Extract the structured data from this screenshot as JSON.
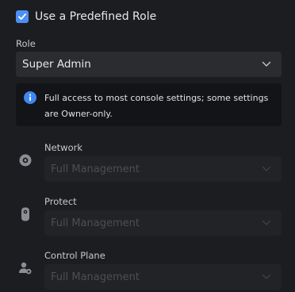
{
  "predefined_role": {
    "label": "Use a Predefined Role",
    "checked": true
  },
  "role": {
    "label": "Role",
    "value": "Super Admin"
  },
  "info": {
    "text": "Full access to most console settings; some settings are Owner-only."
  },
  "permissions": [
    {
      "label": "Network",
      "value": "Full Management",
      "icon": "network-icon"
    },
    {
      "label": "Protect",
      "value": "Full Management",
      "icon": "protect-camera-icon"
    },
    {
      "label": "Control Plane",
      "value": "Full Management",
      "icon": "control-plane-user-gear-icon"
    }
  ],
  "colors": {
    "accent": "#4c8ff5",
    "background": "#1c1d20",
    "field": "#2a2c30",
    "info_bg": "#131417",
    "disabled_field": "#222326"
  }
}
